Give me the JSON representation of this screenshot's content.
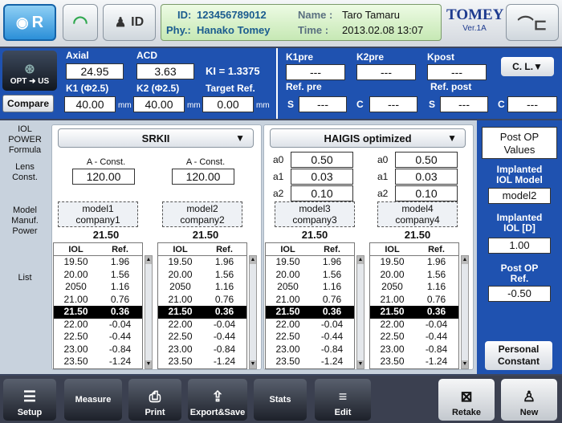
{
  "header": {
    "mode_label": "R",
    "id_label": "ID",
    "patient_id_label": "ID:",
    "patient_id": "123456789012",
    "phy_label": "Phy.:",
    "phy": "Hanako Tomey",
    "name_label": "Name :",
    "name": "Taro Tamaru",
    "time_label": "Time :",
    "time": "2013.02.08  13:07",
    "brand": "TOMEY",
    "version": "Ver.1A"
  },
  "meas": {
    "opt_label": "OPT ➜ US",
    "compare_label": "Compare",
    "axial_label": "Axial",
    "axial": "24.95",
    "acd_label": "ACD",
    "acd": "3.63",
    "ki": "KI = 1.3375",
    "k1_label": "K1 (Φ2.5)",
    "k1": "40.00",
    "k2_label": "K2 (Φ2.5)",
    "k2": "40.00",
    "target_label": "Target Ref.",
    "target": "0.00",
    "unit": "mm",
    "k1pre_label": "K1pre",
    "k1pre": "---",
    "k2pre_label": "K2pre",
    "k2pre": "---",
    "kpost_label": "Kpost",
    "kpost": "---",
    "cl_label": "C. L.▼",
    "refpre_label": "Ref. pre",
    "refpost_label": "Ref. post",
    "s_label": "S",
    "c_label": "C",
    "refpre_s": "---",
    "refpre_c": "---",
    "refpost_s": "---",
    "refpost_c": "---"
  },
  "rows": {
    "formula": "IOL\nPOWER\nFormula",
    "lens": "Lens\nConst.",
    "model": "Model\nManuf.\nPower",
    "list": "List"
  },
  "formulas": [
    {
      "name": "SRKII"
    },
    {
      "name": "HAIGIS optimized"
    }
  ],
  "aconst_label": "A - Const.",
  "iol_header": "IOL",
  "ref_header": "Ref.",
  "panels": [
    {
      "aconst": "120.00",
      "model": "model1",
      "company": "company1",
      "power": "21.50"
    },
    {
      "aconst": "120.00",
      "model": "model2",
      "company": "company2",
      "power": "21.50"
    },
    {
      "a0": "0.50",
      "a1": "0.03",
      "a2": "0.10",
      "model": "model3",
      "company": "company3",
      "power": "21.50"
    },
    {
      "a0": "0.50",
      "a1": "0.03",
      "a2": "0.10",
      "model": "model4",
      "company": "company4",
      "power": "21.50"
    }
  ],
  "a_labels": [
    "a0",
    "a1",
    "a2"
  ],
  "list": [
    [
      "19.50",
      "1.96"
    ],
    [
      "20.00",
      "1.56"
    ],
    [
      "2050",
      "1.16"
    ],
    [
      "21.00",
      "0.76"
    ],
    [
      "21.50",
      "0.36"
    ],
    [
      "22.00",
      "-0.04"
    ],
    [
      "22.50",
      "-0.44"
    ],
    [
      "23.00",
      "-0.84"
    ],
    [
      "23.50",
      "-1.24"
    ]
  ],
  "side": {
    "postop": "Post OP\nValues",
    "implanted_model_label": "Implanted\nIOL Model",
    "implanted_model": "model2",
    "implanted_iol_label": "Implanted\nIOL [D]",
    "implanted_iol": "1.00",
    "postop_ref_label": "Post OP\nRef.",
    "postop_ref": "-0.50",
    "personal": "Personal\nConstant"
  },
  "bottom": {
    "setup": "Setup",
    "measure": "Measure",
    "print": "Print",
    "export": "Export&Save",
    "stats": "Stats",
    "edit": "Edit",
    "retake": "Retake",
    "new": "New"
  }
}
